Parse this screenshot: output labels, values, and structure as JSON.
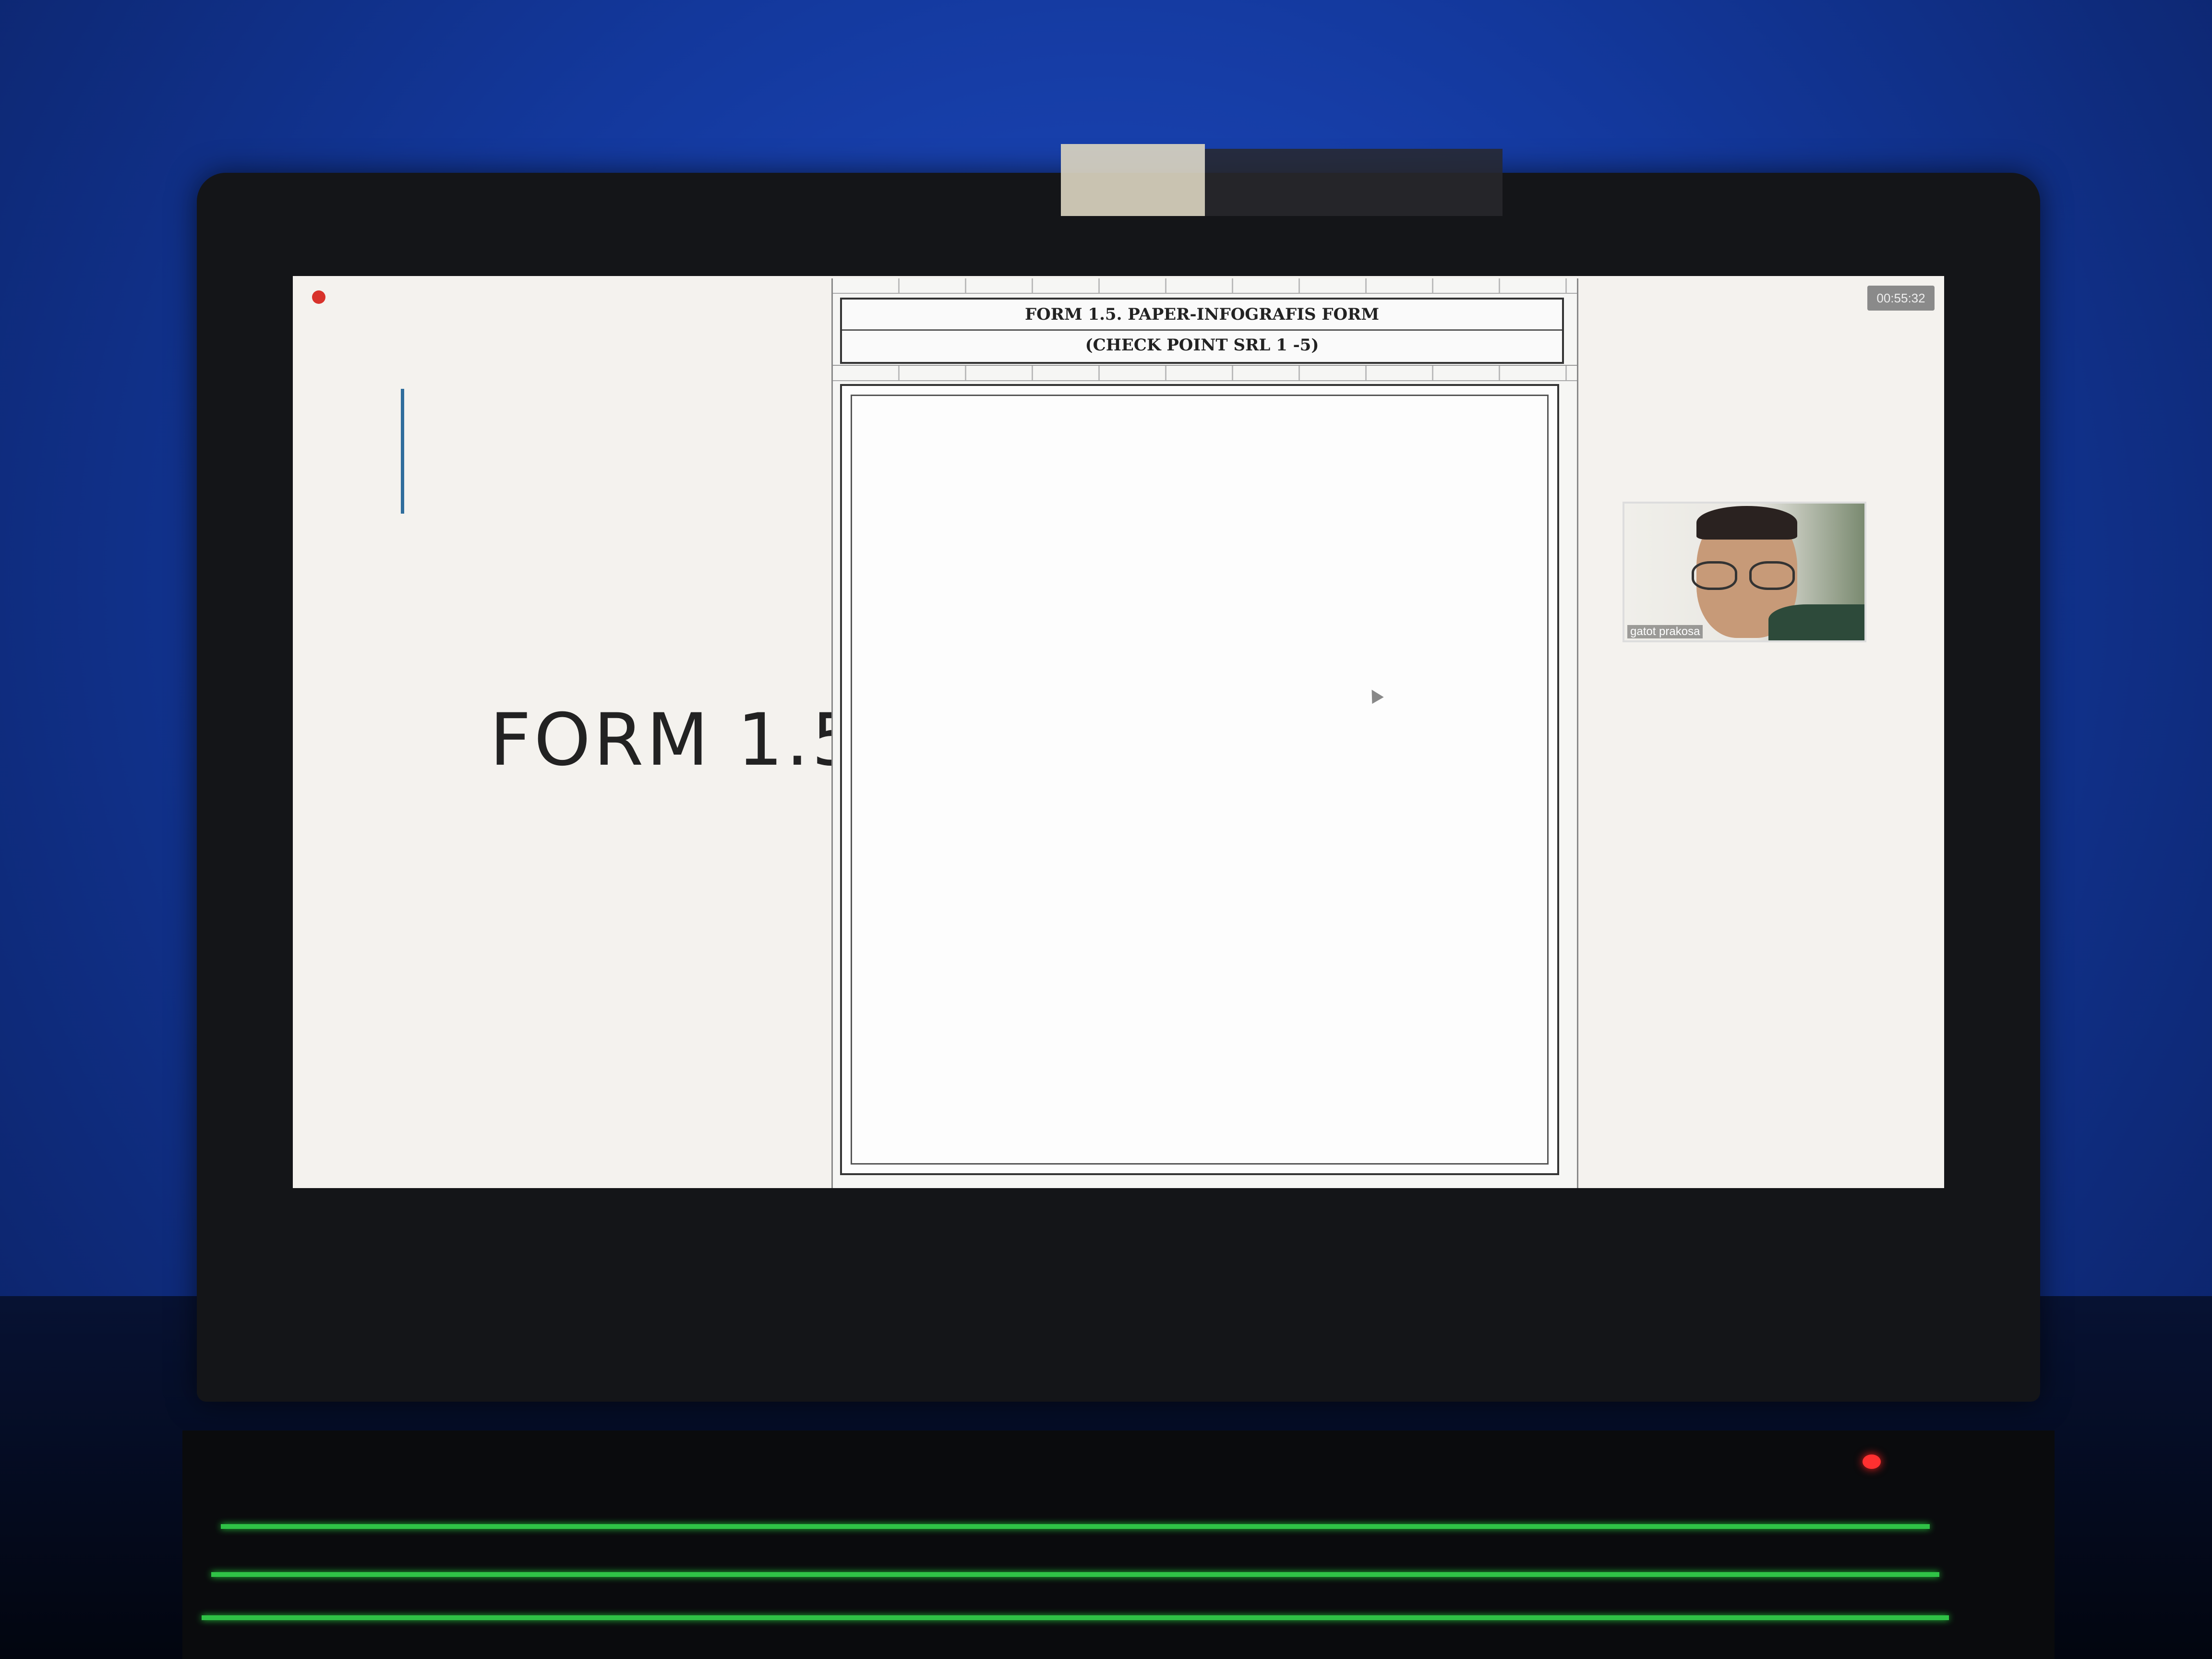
{
  "slide": {
    "title": "FORM 1.5"
  },
  "form": {
    "header_line1": "FORM 1.5. PAPER-INFOGRAFIS FORM",
    "header_line2": "(CHECK POINT SRL 1 -5)"
  },
  "meeting": {
    "timer": "00:55:32",
    "participant_name": "gatot prakosa"
  },
  "colors": {
    "wall": "#13389c",
    "screen_bg": "#f4f2ee",
    "accent_bar": "#2f6d9c",
    "keyboard_glow": "#3cff5a",
    "recording_dot": "#d8322b"
  },
  "icons": {
    "recording": "recording-dot-icon",
    "cursor": "mouse-cursor-icon"
  }
}
